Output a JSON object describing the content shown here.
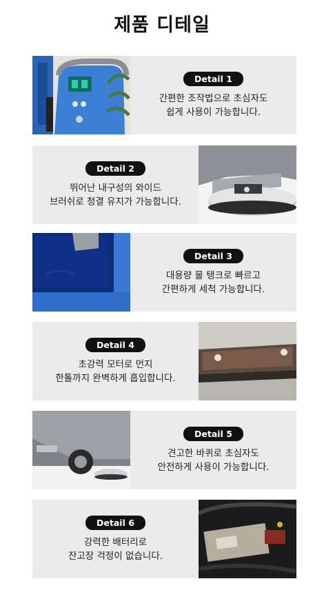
{
  "page_title": "제품 디테일",
  "details": [
    {
      "badge": "Detail 1",
      "line1": "간편한 조작법으로 초심자도",
      "line2": "쉽게 사용이 가능합니다."
    },
    {
      "badge": "Detail 2",
      "line1": "뛰어난 내구성의 와이드",
      "line2": "브러쉬로 청결 유지가 가능합니다."
    },
    {
      "badge": "Detail 3",
      "line1": "대용량 물 탱크로 빠르고",
      "line2": "간편하게 세척 가능합니다."
    },
    {
      "badge": "Detail 4",
      "line1": "초강력 모터로 먼지",
      "line2": "한톨까지 완벽하게 흡입합니다."
    },
    {
      "badge": "Detail 5",
      "line1": "견고한 바퀴로 초심자도",
      "line2": "안전하게 사용이 가능합니다."
    },
    {
      "badge": "Detail 6",
      "line1": "강력한 배터리로",
      "line2": "잔고장 걱정이 없습니다."
    }
  ]
}
